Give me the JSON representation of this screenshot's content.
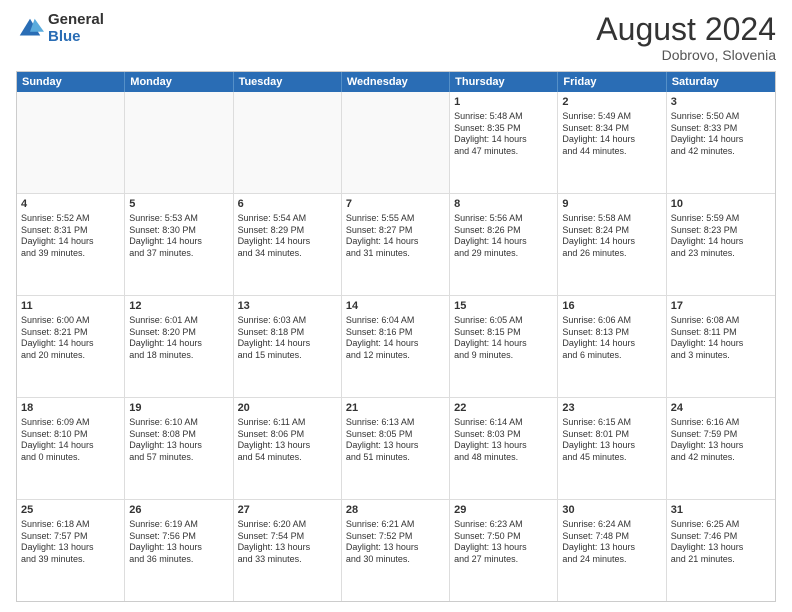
{
  "logo": {
    "general": "General",
    "blue": "Blue"
  },
  "title": {
    "month_year": "August 2024",
    "location": "Dobrovo, Slovenia"
  },
  "calendar": {
    "headers": [
      "Sunday",
      "Monday",
      "Tuesday",
      "Wednesday",
      "Thursday",
      "Friday",
      "Saturday"
    ],
    "weeks": [
      [
        {
          "day": "",
          "empty": true,
          "lines": []
        },
        {
          "day": "",
          "empty": true,
          "lines": []
        },
        {
          "day": "",
          "empty": true,
          "lines": []
        },
        {
          "day": "",
          "empty": true,
          "lines": []
        },
        {
          "day": "1",
          "empty": false,
          "lines": [
            "Sunrise: 5:48 AM",
            "Sunset: 8:35 PM",
            "Daylight: 14 hours",
            "and 47 minutes."
          ]
        },
        {
          "day": "2",
          "empty": false,
          "lines": [
            "Sunrise: 5:49 AM",
            "Sunset: 8:34 PM",
            "Daylight: 14 hours",
            "and 44 minutes."
          ]
        },
        {
          "day": "3",
          "empty": false,
          "lines": [
            "Sunrise: 5:50 AM",
            "Sunset: 8:33 PM",
            "Daylight: 14 hours",
            "and 42 minutes."
          ]
        }
      ],
      [
        {
          "day": "4",
          "empty": false,
          "lines": [
            "Sunrise: 5:52 AM",
            "Sunset: 8:31 PM",
            "Daylight: 14 hours",
            "and 39 minutes."
          ]
        },
        {
          "day": "5",
          "empty": false,
          "lines": [
            "Sunrise: 5:53 AM",
            "Sunset: 8:30 PM",
            "Daylight: 14 hours",
            "and 37 minutes."
          ]
        },
        {
          "day": "6",
          "empty": false,
          "lines": [
            "Sunrise: 5:54 AM",
            "Sunset: 8:29 PM",
            "Daylight: 14 hours",
            "and 34 minutes."
          ]
        },
        {
          "day": "7",
          "empty": false,
          "lines": [
            "Sunrise: 5:55 AM",
            "Sunset: 8:27 PM",
            "Daylight: 14 hours",
            "and 31 minutes."
          ]
        },
        {
          "day": "8",
          "empty": false,
          "lines": [
            "Sunrise: 5:56 AM",
            "Sunset: 8:26 PM",
            "Daylight: 14 hours",
            "and 29 minutes."
          ]
        },
        {
          "day": "9",
          "empty": false,
          "lines": [
            "Sunrise: 5:58 AM",
            "Sunset: 8:24 PM",
            "Daylight: 14 hours",
            "and 26 minutes."
          ]
        },
        {
          "day": "10",
          "empty": false,
          "lines": [
            "Sunrise: 5:59 AM",
            "Sunset: 8:23 PM",
            "Daylight: 14 hours",
            "and 23 minutes."
          ]
        }
      ],
      [
        {
          "day": "11",
          "empty": false,
          "lines": [
            "Sunrise: 6:00 AM",
            "Sunset: 8:21 PM",
            "Daylight: 14 hours",
            "and 20 minutes."
          ]
        },
        {
          "day": "12",
          "empty": false,
          "lines": [
            "Sunrise: 6:01 AM",
            "Sunset: 8:20 PM",
            "Daylight: 14 hours",
            "and 18 minutes."
          ]
        },
        {
          "day": "13",
          "empty": false,
          "lines": [
            "Sunrise: 6:03 AM",
            "Sunset: 8:18 PM",
            "Daylight: 14 hours",
            "and 15 minutes."
          ]
        },
        {
          "day": "14",
          "empty": false,
          "lines": [
            "Sunrise: 6:04 AM",
            "Sunset: 8:16 PM",
            "Daylight: 14 hours",
            "and 12 minutes."
          ]
        },
        {
          "day": "15",
          "empty": false,
          "lines": [
            "Sunrise: 6:05 AM",
            "Sunset: 8:15 PM",
            "Daylight: 14 hours",
            "and 9 minutes."
          ]
        },
        {
          "day": "16",
          "empty": false,
          "lines": [
            "Sunrise: 6:06 AM",
            "Sunset: 8:13 PM",
            "Daylight: 14 hours",
            "and 6 minutes."
          ]
        },
        {
          "day": "17",
          "empty": false,
          "lines": [
            "Sunrise: 6:08 AM",
            "Sunset: 8:11 PM",
            "Daylight: 14 hours",
            "and 3 minutes."
          ]
        }
      ],
      [
        {
          "day": "18",
          "empty": false,
          "lines": [
            "Sunrise: 6:09 AM",
            "Sunset: 8:10 PM",
            "Daylight: 14 hours",
            "and 0 minutes."
          ]
        },
        {
          "day": "19",
          "empty": false,
          "lines": [
            "Sunrise: 6:10 AM",
            "Sunset: 8:08 PM",
            "Daylight: 13 hours",
            "and 57 minutes."
          ]
        },
        {
          "day": "20",
          "empty": false,
          "lines": [
            "Sunrise: 6:11 AM",
            "Sunset: 8:06 PM",
            "Daylight: 13 hours",
            "and 54 minutes."
          ]
        },
        {
          "day": "21",
          "empty": false,
          "lines": [
            "Sunrise: 6:13 AM",
            "Sunset: 8:05 PM",
            "Daylight: 13 hours",
            "and 51 minutes."
          ]
        },
        {
          "day": "22",
          "empty": false,
          "lines": [
            "Sunrise: 6:14 AM",
            "Sunset: 8:03 PM",
            "Daylight: 13 hours",
            "and 48 minutes."
          ]
        },
        {
          "day": "23",
          "empty": false,
          "lines": [
            "Sunrise: 6:15 AM",
            "Sunset: 8:01 PM",
            "Daylight: 13 hours",
            "and 45 minutes."
          ]
        },
        {
          "day": "24",
          "empty": false,
          "lines": [
            "Sunrise: 6:16 AM",
            "Sunset: 7:59 PM",
            "Daylight: 13 hours",
            "and 42 minutes."
          ]
        }
      ],
      [
        {
          "day": "25",
          "empty": false,
          "lines": [
            "Sunrise: 6:18 AM",
            "Sunset: 7:57 PM",
            "Daylight: 13 hours",
            "and 39 minutes."
          ]
        },
        {
          "day": "26",
          "empty": false,
          "lines": [
            "Sunrise: 6:19 AM",
            "Sunset: 7:56 PM",
            "Daylight: 13 hours",
            "and 36 minutes."
          ]
        },
        {
          "day": "27",
          "empty": false,
          "lines": [
            "Sunrise: 6:20 AM",
            "Sunset: 7:54 PM",
            "Daylight: 13 hours",
            "and 33 minutes."
          ]
        },
        {
          "day": "28",
          "empty": false,
          "lines": [
            "Sunrise: 6:21 AM",
            "Sunset: 7:52 PM",
            "Daylight: 13 hours",
            "and 30 minutes."
          ]
        },
        {
          "day": "29",
          "empty": false,
          "lines": [
            "Sunrise: 6:23 AM",
            "Sunset: 7:50 PM",
            "Daylight: 13 hours",
            "and 27 minutes."
          ]
        },
        {
          "day": "30",
          "empty": false,
          "lines": [
            "Sunrise: 6:24 AM",
            "Sunset: 7:48 PM",
            "Daylight: 13 hours",
            "and 24 minutes."
          ]
        },
        {
          "day": "31",
          "empty": false,
          "lines": [
            "Sunrise: 6:25 AM",
            "Sunset: 7:46 PM",
            "Daylight: 13 hours",
            "and 21 minutes."
          ]
        }
      ]
    ]
  }
}
